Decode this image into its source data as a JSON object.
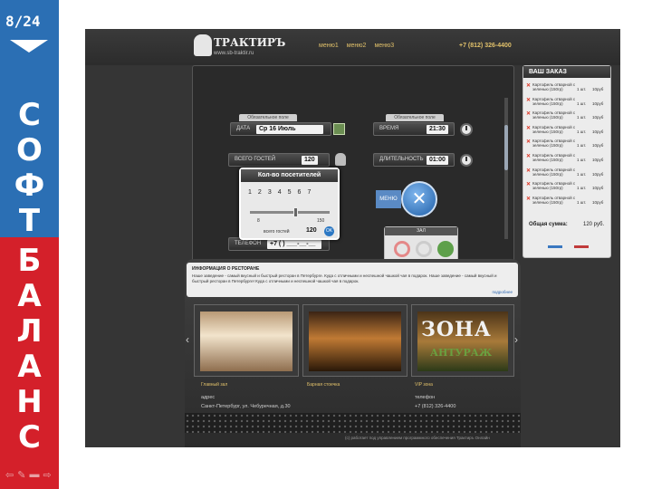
{
  "slide": {
    "number": "8/24",
    "word1": [
      "С",
      "О",
      "Ф",
      "Т"
    ],
    "word2": [
      "Б",
      "А",
      "Л",
      "А",
      "Н",
      "С"
    ]
  },
  "site": {
    "brand": "ТРАКТИРЪ",
    "url": "www.sb-traktir.ru",
    "menu": [
      "меню1",
      "меню2",
      "меню3"
    ],
    "phone": "+7 (812) 326-4400"
  },
  "reservation": {
    "required_tag": "Обязательное поле",
    "date_label": "ДАТА",
    "date_value": "Ср 16 Июль",
    "time_label": "ВРЕМЯ",
    "time_value": "21:30",
    "guests_label": "ВСЕГО ГОСТЕЙ",
    "guests_value": "120",
    "duration_label": "ДЛИТЕЛЬНОСТЬ",
    "duration_value": "01:00",
    "menu_tile": "МЕНЮ",
    "phone_label": "ТЕЛЕФОН",
    "phone_value": "+7 (   ) ___-__-__",
    "hall_tab": "ЗАЛ"
  },
  "visitors_popup": {
    "title": "Кол-во посетителей",
    "numbers": [
      "1",
      "2",
      "3",
      "4",
      "5",
      "6",
      "7"
    ],
    "range_min": "8",
    "range_max": "150",
    "total_label": "всего гостей",
    "total_value": "120",
    "ok": "OK"
  },
  "order": {
    "title": "ВАШ ЗАКАЗ",
    "items": [
      {
        "name": "Картофель отварной с зеленью (150гр)",
        "qty": "1 шт.",
        "price": "10руб"
      },
      {
        "name": "Картофель отварной с зеленью (150гр)",
        "qty": "1 шт.",
        "price": "10руб"
      },
      {
        "name": "Картофель отварной с зеленью (150гр)",
        "qty": "1 шт.",
        "price": "10руб"
      },
      {
        "name": "Картофель отварной с зеленью (150гр)",
        "qty": "1 шт.",
        "price": "10руб"
      },
      {
        "name": "Картофель отварной с зеленью (150гр)",
        "qty": "1 шт.",
        "price": "10руб"
      },
      {
        "name": "Картофель отварной с зеленью (150гр)",
        "qty": "1 шт.",
        "price": "10руб"
      },
      {
        "name": "Картофель отварной с зеленью (150гр)",
        "qty": "1 шт.",
        "price": "10руб"
      },
      {
        "name": "Картофель отварной с зеленью (150гр)",
        "qty": "1 шт.",
        "price": "10руб"
      },
      {
        "name": "Картофель отварной с зеленью (150гр)",
        "qty": "1 шт.",
        "price": "10руб"
      }
    ],
    "sum_label": "Общая сумма:",
    "sum_value": "120 руб."
  },
  "info": {
    "title": "ИНФОРМАЦИЯ О РЕСТОРАНЕ",
    "text": "Наше заведение - самый вкусный и быстрый ресторан в Петербурге. Куда с отличными и неспешной чашкой чая в подарок. Наше заведение - самый вкусный и быстрый ресторан в Петербурге! Куда с отличными и неспешной чашкой чая в подарок.",
    "more": "подробнее"
  },
  "gallery": [
    {
      "caption": "Главный зал"
    },
    {
      "caption": "Барная стоечка"
    },
    {
      "caption": "VIP зона",
      "sign1": "ЗОНА",
      "sign2": "АНТУРАЖ"
    }
  ],
  "contacts": {
    "address_label": "адрес",
    "address": "Санкт-Петербург, ул. Чебуречная, д.30",
    "phone_label": "телефон",
    "phone": "+7 (812) 326-4400"
  },
  "footer": "(с) работает под управлением программного обеспечения Трактиръ Онлайн"
}
